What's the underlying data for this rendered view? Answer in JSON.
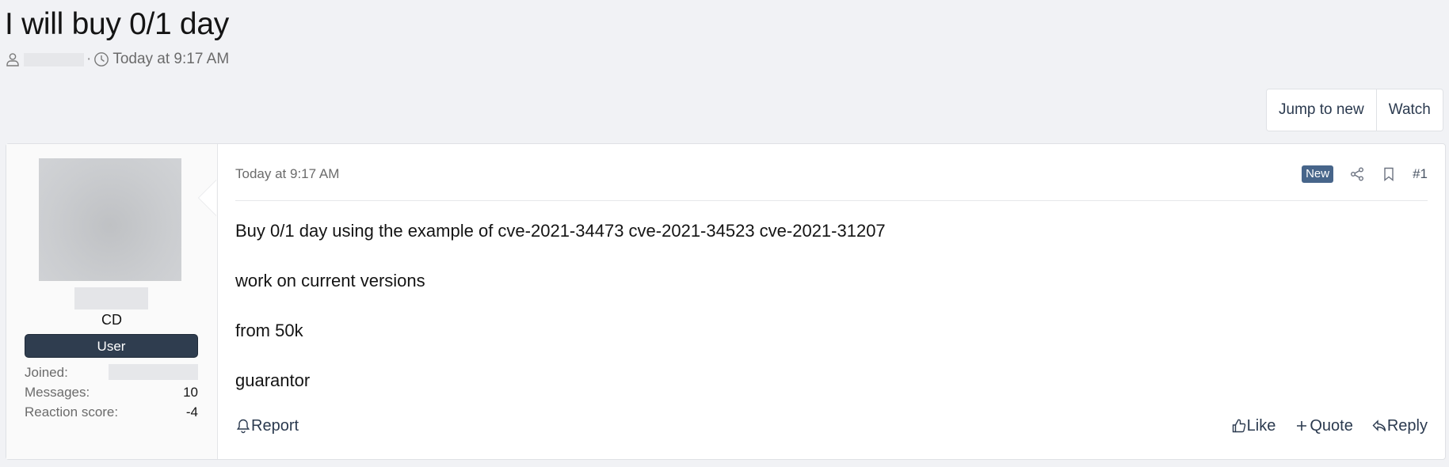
{
  "thread": {
    "title": "I will buy 0/1 day",
    "separator": "·",
    "start_time": "Today at 9:17 AM"
  },
  "buttons": {
    "jump_to_new": "Jump to new",
    "watch": "Watch"
  },
  "user": {
    "title": "CD",
    "banner": "User",
    "stats": {
      "joined_label": "Joined:",
      "messages_label": "Messages:",
      "messages_value": "10",
      "reaction_label": "Reaction score:",
      "reaction_value": "-4"
    }
  },
  "post": {
    "date": "Today at 9:17 AM",
    "badge": "New",
    "number": "#1",
    "body": [
      "Buy 0/1 day using the example of cve-2021-34473 cve-2021-34523 cve-2021-31207",
      "work on current versions",
      "from 50k",
      "guarantor"
    ],
    "footer": {
      "report": "Report",
      "like": "Like",
      "quote": "Quote",
      "reply": "Reply"
    }
  },
  "icons": {
    "user": "user-icon",
    "clock": "clock-icon",
    "share": "share-icon",
    "bookmark": "bookmark-icon",
    "bell": "bell-icon",
    "thumbs_up": "thumbs-up-icon",
    "plus": "plus-icon",
    "reply": "reply-icon"
  },
  "colors": {
    "background": "#f1f2f5",
    "banner": "#2f3d4f",
    "badge": "#47658a",
    "link": "#2b3a4f"
  }
}
